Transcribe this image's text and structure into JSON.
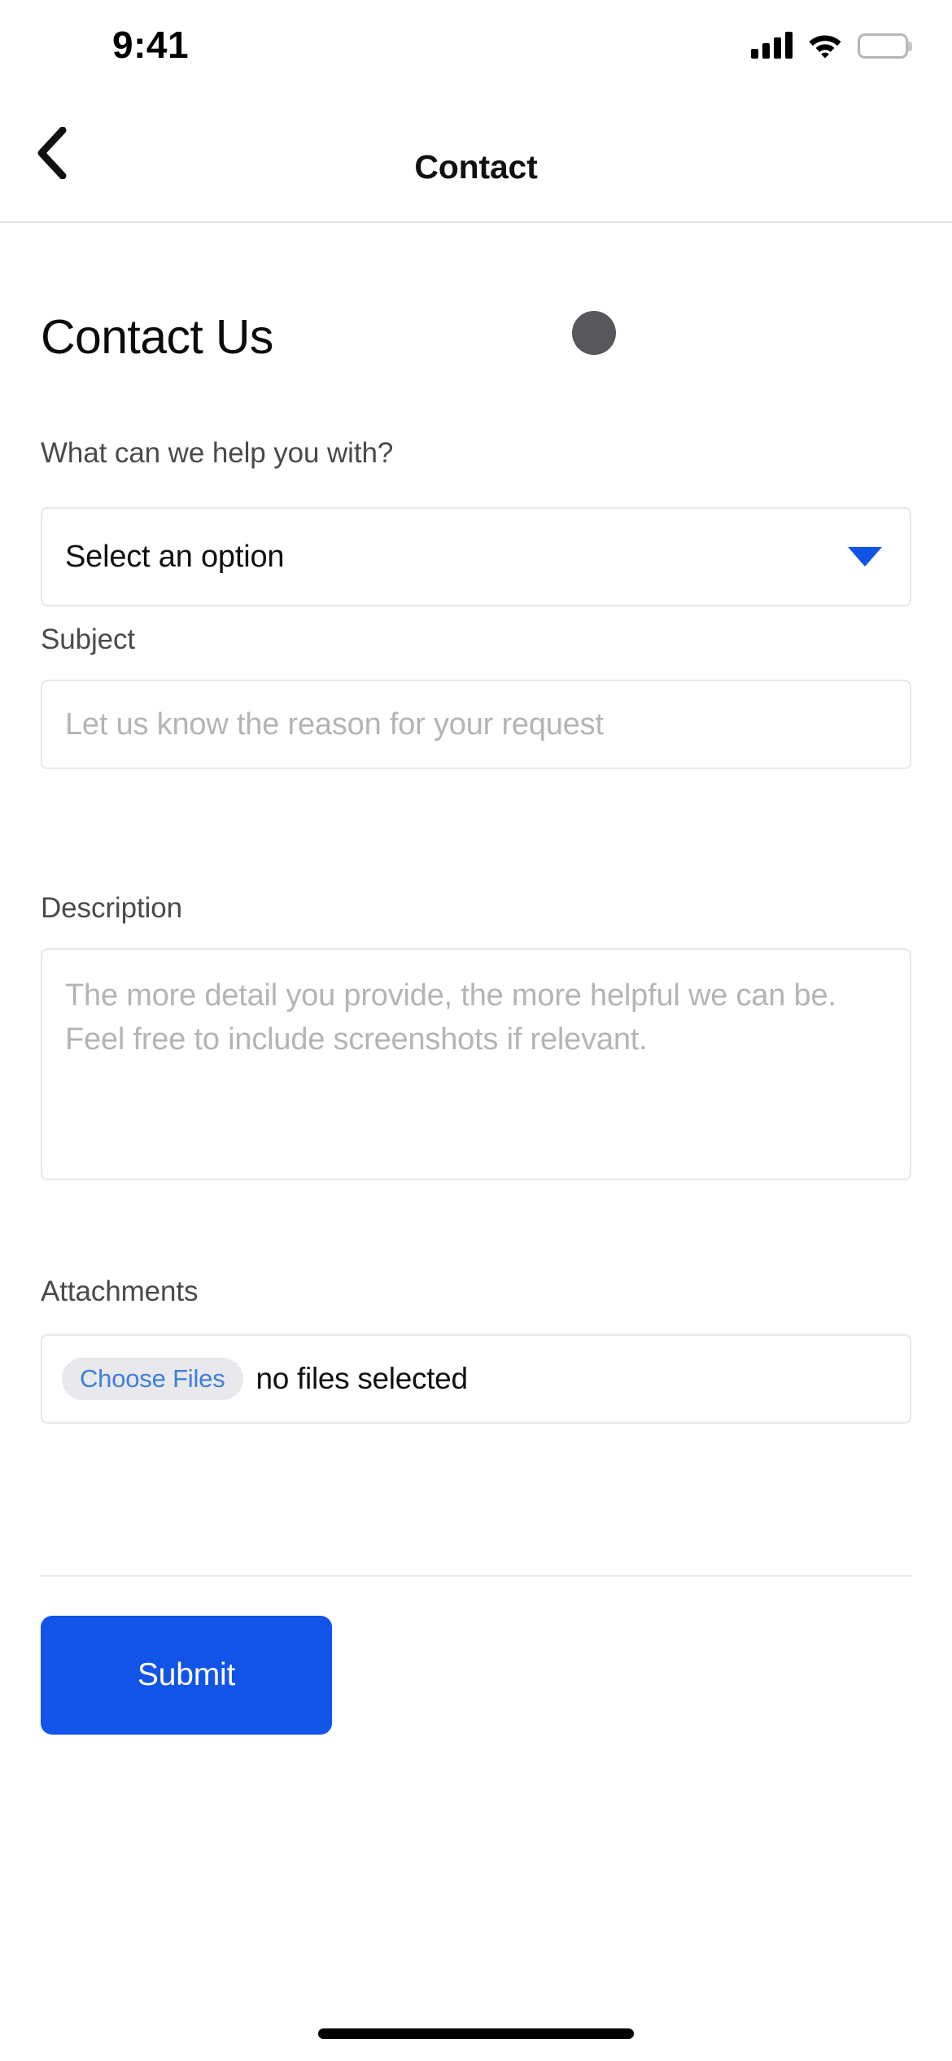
{
  "status_bar": {
    "time": "9:41",
    "cellular_icon": "cellular-signal-icon",
    "wifi_icon": "wifi-icon",
    "battery_icon": "battery-full-icon"
  },
  "nav": {
    "back_icon": "chevron-left-icon",
    "title": "Contact"
  },
  "page": {
    "heading": "Contact Us"
  },
  "form": {
    "topic": {
      "label": "What can we help you with?",
      "selected_value": "Select an option",
      "dropdown_icon": "chevron-down-icon"
    },
    "subject": {
      "label": "Subject",
      "value": "",
      "placeholder": "Let us know the reason for your request"
    },
    "description": {
      "label": "Description",
      "value": "",
      "placeholder": "The more detail you provide, the more helpful we can be. Feel free to include screenshots if relevant."
    },
    "attachments": {
      "label": "Attachments",
      "choose_button": "Choose Files",
      "status": "no files selected"
    },
    "submit_label": "Submit"
  },
  "colors": {
    "accent_blue": "#1254e8",
    "link_blue": "#3f7fd6",
    "border_gray": "#e8e8e8",
    "placeholder_gray": "#b4b4b4",
    "label_gray": "#4a4a4a",
    "cursor_gray": "#58585c"
  },
  "home_indicator": "home-indicator-bar"
}
